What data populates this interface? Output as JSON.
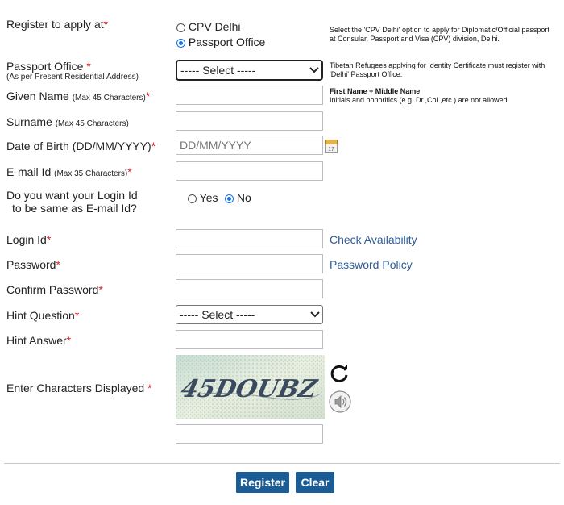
{
  "register_at": {
    "label": "Register to apply at",
    "options": [
      "CPV Delhi",
      "Passport Office"
    ],
    "selected": "Passport Office",
    "note": "Select the 'CPV Delhi' option to apply for Diplomatic/Official passport at Consular, Passport and Visa (CPV) division, Delhi."
  },
  "passport_office": {
    "label": "Passport Office",
    "sub": "(As per Present Residential Address)",
    "select_value": "----- Select -----",
    "note": "Tibetan Refugees applying for Identity Certificate must register with 'Delhi' Passport Office."
  },
  "given_name": {
    "label": "Given Name",
    "sub": "(Max 45 Characters)",
    "note_title": "First Name + Middle Name",
    "note": "Initials and honorifics (e.g. Dr.,Col.,etc.) are not allowed."
  },
  "surname": {
    "label": "Surname",
    "sub": "(Max 45 Characters)"
  },
  "dob": {
    "label": "Date of Birth (DD/MM/YYYY)",
    "placeholder": "DD/MM/YYYY"
  },
  "email": {
    "label": "E-mail Id",
    "sub": "(Max 35 Characters)"
  },
  "login_same": {
    "label_line1": "Do you want your Login Id",
    "label_line2": "to be same as E-mail Id?",
    "yes": "Yes",
    "no": "No",
    "selected": "No"
  },
  "login_id": {
    "label": "Login Id",
    "link": "Check Availability"
  },
  "password": {
    "label": "Password",
    "link": "Password Policy"
  },
  "confirm_password": {
    "label": "Confirm Password"
  },
  "hint_question": {
    "label": "Hint Question",
    "select_value": "----- Select -----"
  },
  "hint_answer": {
    "label": "Hint Answer"
  },
  "captcha": {
    "label": "Enter Characters Displayed",
    "text": "45DOUBZ"
  },
  "required_mark": "*",
  "buttons": {
    "register": "Register",
    "clear": "Clear"
  },
  "colors": {
    "accent": "#1a5d96",
    "link": "#2e5c9a",
    "required": "#dd2222"
  }
}
